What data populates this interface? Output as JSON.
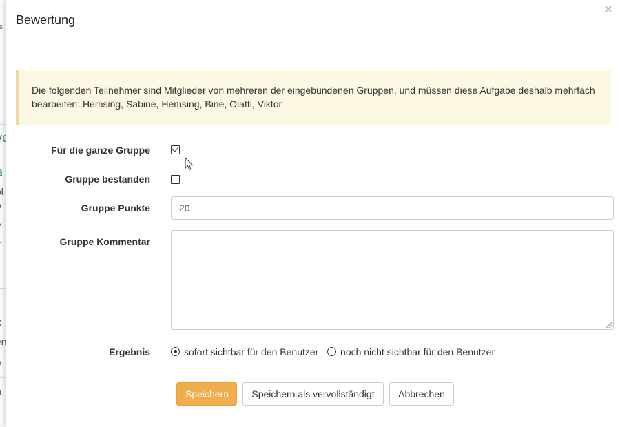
{
  "background": {
    "fragments": [
      "ss",
      "ve",
      "a",
      "ol",
      "ö",
      "e",
      "T",
      "k",
      "en",
      "e",
      "n"
    ]
  },
  "modal": {
    "title": "Bewertung",
    "close_glyph": "×",
    "alert_text": "Die folgenden Teilnehmer sind Mitglieder von mehreren der eingebundenen Gruppen, und müssen diese Aufgabe deshalb mehrfach bearbeiten: Hemsing, Sabine, Hemsing, Bine, Olatti, Viktor"
  },
  "form": {
    "whole_group": {
      "label": "Für die ganze Gruppe",
      "checked": true
    },
    "group_passed": {
      "label": "Gruppe bestanden",
      "checked": false
    },
    "group_points": {
      "label": "Gruppe Punkte",
      "value": "20"
    },
    "group_comment": {
      "label": "Gruppe Kommentar",
      "value": ""
    },
    "result": {
      "label": "Ergebnis",
      "options": [
        {
          "label": "sofort sichtbar für den Benutzer",
          "selected": true
        },
        {
          "label": "noch nicht sichtbar für den Benutzer",
          "selected": false
        }
      ]
    }
  },
  "buttons": {
    "save": "Speichern",
    "save_complete": "Speichern als vervollständigt",
    "cancel": "Abbrechen"
  },
  "colors": {
    "primary": "#f0ad4e",
    "alert_bg": "#fcf8e3",
    "alert_border": "#f0d9a0"
  }
}
